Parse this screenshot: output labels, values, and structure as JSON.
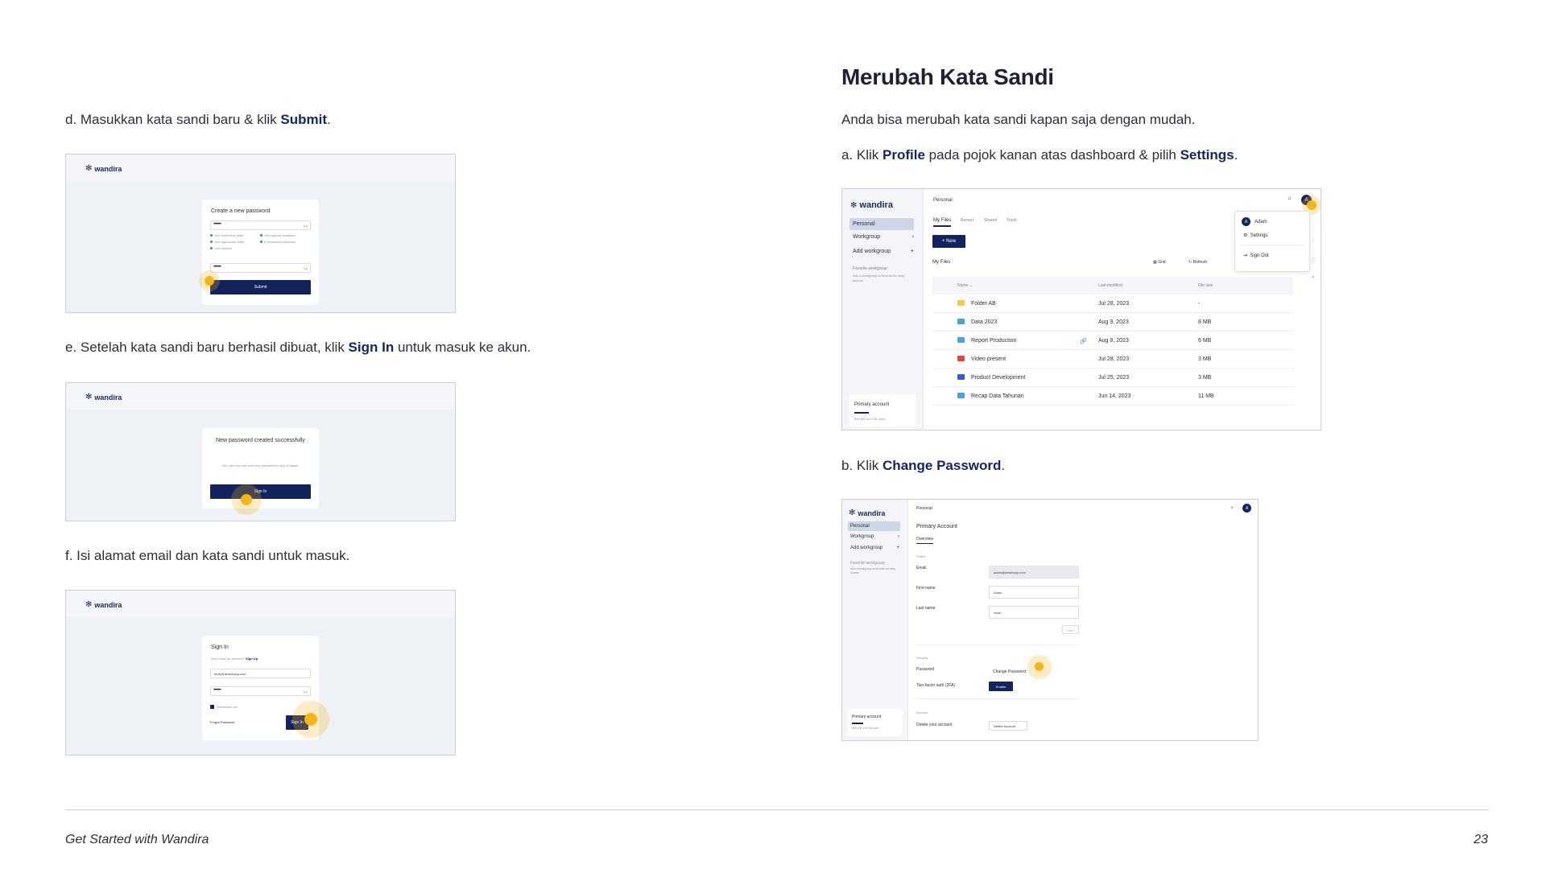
{
  "left": {
    "step_d": {
      "prefix": "d. Masukkan kata sandi baru & klik ",
      "bold": "Submit",
      "suffix": "."
    },
    "step_e": {
      "prefix": "e. Setelah kata sandi baru berhasil dibuat, klik ",
      "bold": "Sign In",
      "suffix": " untuk masuk ke akun."
    },
    "step_f": {
      "text": "f. Isi alamat email dan kata sandi untuk masuk."
    },
    "shot_d": {
      "logo": "wandira",
      "title": "Create a new password",
      "password_mask": "••••••••",
      "confirm_mask": "••••••••",
      "rules": [
        "One lowercase letter",
        "One special character",
        "One uppercase letter",
        "8 characters minimum",
        "One number"
      ],
      "submit": "Submit"
    },
    "shot_e": {
      "logo": "wandira",
      "title": "New password created successfully",
      "body": "You can now use your new password to sign in again.",
      "button": "Sign In"
    },
    "shot_f": {
      "logo": "wandira",
      "title": "Sign In",
      "no_account": "Don't have an account?",
      "signup": "Sign Up",
      "email": "andy@dwantopip.com",
      "password_mask": "••••••••",
      "remember": "Remember me",
      "forgot": "Forgot Password",
      "button": "Sign In"
    }
  },
  "right": {
    "heading": "Merubah Kata Sandi",
    "intro": "Anda bisa merubah kata sandi kapan saja dengan mudah.",
    "step_a": {
      "prefix": "a. Klik ",
      "bold1": "Profile",
      "mid": " pada pojok kanan atas dashboard & pilih ",
      "bold2": "Settings",
      "suffix": "."
    },
    "step_b": {
      "prefix": "b. Klik ",
      "bold": "Change Password",
      "suffix": "."
    },
    "app_a": {
      "logo": "wandira",
      "breadcrumb": "Personal",
      "sidebar": [
        "Personal",
        "Workgroup",
        "Add workgroup"
      ],
      "fav_title": "Favorite workgroup",
      "fav_hint": "Add a workgroup to favorite for easy access",
      "primary": "Primary account",
      "storage": "600 MB of 5 GB used",
      "tabs": [
        "My Files",
        "Recent",
        "Shared",
        "Trash"
      ],
      "new_btn": "+ New",
      "section": "My Files",
      "grid": "Grid",
      "refresh": "Refresh",
      "columns": [
        "Name",
        "Last modified",
        "File size"
      ],
      "files": [
        {
          "name": "Folder AB",
          "date": "Jul 28, 2023",
          "size": "-",
          "color": "#f2c94c"
        },
        {
          "name": "Data 2023",
          "date": "Aug 9, 2023",
          "size": "8 MB",
          "color": "#4aa3df"
        },
        {
          "name": "Report Production",
          "date": "Aug 8, 2023",
          "size": "6 MB",
          "color": "#4aa3df"
        },
        {
          "name": "Video present",
          "date": "Jul 28, 2023",
          "size": "3 MB",
          "color": "#e0483e"
        },
        {
          "name": "Product Development",
          "date": "Jul 25, 2023",
          "size": "3 MB",
          "color": "#2f5fd0"
        },
        {
          "name": "Recap Data Tahunan",
          "date": "Jun 14, 2023",
          "size": "11 MB",
          "color": "#4aa3df"
        }
      ],
      "menu": {
        "user": "Adam",
        "avatar": "A",
        "settings": "Settings",
        "signout": "Sign Out"
      }
    },
    "app_b": {
      "logo": "wandira",
      "breadcrumb": "Personal",
      "sidebar": [
        "Personal",
        "Workgroup",
        "Add workgroup"
      ],
      "fav_title": "Favorite workgroup",
      "fav_hint": "Add a workgroup to favorite for easy access",
      "primary": "Primary account",
      "storage": "600 MB of 5 GB used",
      "title": "Primary Account",
      "tab": "Overview",
      "profile": "Profile",
      "email_label": "Email",
      "email_value": "adam@desktopip.com",
      "first_label": "First name",
      "first_value": "Adam",
      "last_label": "Last name",
      "last_value": "Noah",
      "save": "Save",
      "security": "Security",
      "password_label": "Password",
      "change_pw": "Change Password",
      "twofa_label": "Two-factor auth (2FA)",
      "enable": "Enable",
      "account": "Account",
      "delete_label": "Delete your account",
      "delete_btn": "Delete Account",
      "avatar": "A"
    }
  },
  "footer": {
    "left": "Get Started with Wandira",
    "page": "23"
  },
  "colors": {
    "navy": "#13235e",
    "accent": "#f5b41b",
    "link": "#14256b"
  }
}
